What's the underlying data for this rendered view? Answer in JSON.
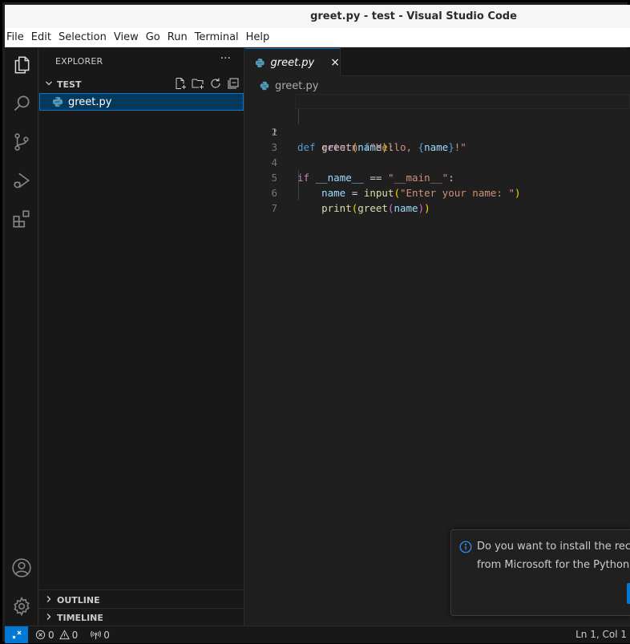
{
  "window": {
    "title": "greet.py - test - Visual Studio Code"
  },
  "menu": [
    "File",
    "Edit",
    "Selection",
    "View",
    "Go",
    "Run",
    "Terminal",
    "Help"
  ],
  "activity_bar": {
    "top_icons": [
      "files-icon",
      "search-icon",
      "source-control-icon",
      "run-debug-icon",
      "extensions-icon"
    ],
    "bottom_icons": [
      "account-icon",
      "settings-gear-icon"
    ]
  },
  "sidebar": {
    "title": "EXPLORER",
    "more": "···",
    "folder": "TEST",
    "files": [
      {
        "name": "greet.py",
        "selected": true
      }
    ],
    "outline": "OUTLINE",
    "timeline": "TIMELINE"
  },
  "editor": {
    "tab": {
      "label": "greet.py",
      "close": "×"
    },
    "breadcrumb": "greet.py",
    "lines": [
      {
        "n": "1"
      },
      {
        "n": "2"
      },
      {
        "n": "3"
      },
      {
        "n": "4"
      },
      {
        "n": "5"
      },
      {
        "n": "6"
      },
      {
        "n": "7"
      }
    ],
    "tokens": {
      "def": "def",
      "greet": "greet",
      "lp": "(",
      "name": "name",
      "rp": ")",
      "colon": ":",
      "return": "return",
      "f": "f",
      "s1": "\"Hello, ",
      "lb": "{",
      "rb": "}",
      "s2": "!\"",
      "if": "if",
      "dunder_name": "__name__",
      "eq": "==",
      "main_str": "\"__main__\"",
      "assign": "=",
      "input": "input",
      "prompt": "\"Enter your name: \"",
      "print": "print"
    }
  },
  "notification": {
    "line1": "Do you want to install the recom",
    "line2": "from Microsoft for the Python la"
  },
  "status": {
    "errors": "0",
    "warnings": "0",
    "ports": "0",
    "position": "Ln 1, Col 1"
  },
  "colors": {
    "accent": "#0078d4",
    "selection": "#04395e",
    "python_icon": "#519aba"
  }
}
